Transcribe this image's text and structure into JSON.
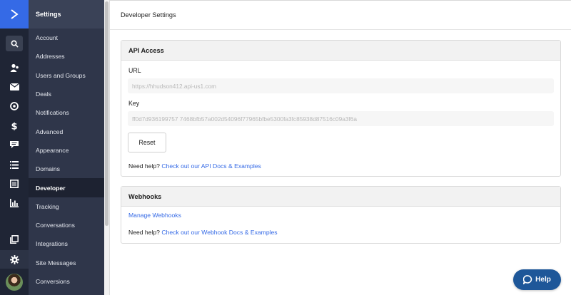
{
  "nav": {
    "title": "Settings",
    "items": [
      {
        "label": "Account"
      },
      {
        "label": "Addresses"
      },
      {
        "label": "Users and Groups"
      },
      {
        "label": "Deals"
      },
      {
        "label": "Notifications"
      },
      {
        "label": "Advanced"
      },
      {
        "label": "Appearance"
      },
      {
        "label": "Domains"
      },
      {
        "label": "Developer",
        "active": true
      },
      {
        "label": "Tracking"
      },
      {
        "label": "Conversations"
      },
      {
        "label": "Integrations"
      },
      {
        "label": "Site Messages"
      },
      {
        "label": "Conversions"
      }
    ]
  },
  "rail": {
    "icons": [
      "logo-chevron-icon",
      "search-icon",
      "contacts-icon",
      "mail-icon",
      "automation-icon",
      "dollar-icon",
      "chat-icon",
      "list-icon",
      "document-icon",
      "chart-icon",
      "pages-icon",
      "gear-icon",
      "avatar"
    ]
  },
  "page": {
    "title": "Developer Settings"
  },
  "api": {
    "heading": "API Access",
    "url_label": "URL",
    "url_value": "https://hhudson412.api-us1.com",
    "key_label": "Key",
    "key_value": "ff0d7d936199757 7468bfb57a002d54096f77965bfbe5300fa3fc85938d87516c09a3f6a",
    "reset_label": "Reset",
    "help_prefix": "Need help?",
    "help_link": "Check out our API Docs & Examples"
  },
  "webhooks": {
    "heading": "Webhooks",
    "manage_link": "Manage Webhooks",
    "help_prefix": "Need help?",
    "help_link": "Check out our Webhook Docs & Examples"
  },
  "help_button": {
    "label": "Help"
  },
  "colors": {
    "brand": "#356ae6",
    "rail": "#1f2535",
    "nav": "#2f364a",
    "help": "#1e5799"
  }
}
